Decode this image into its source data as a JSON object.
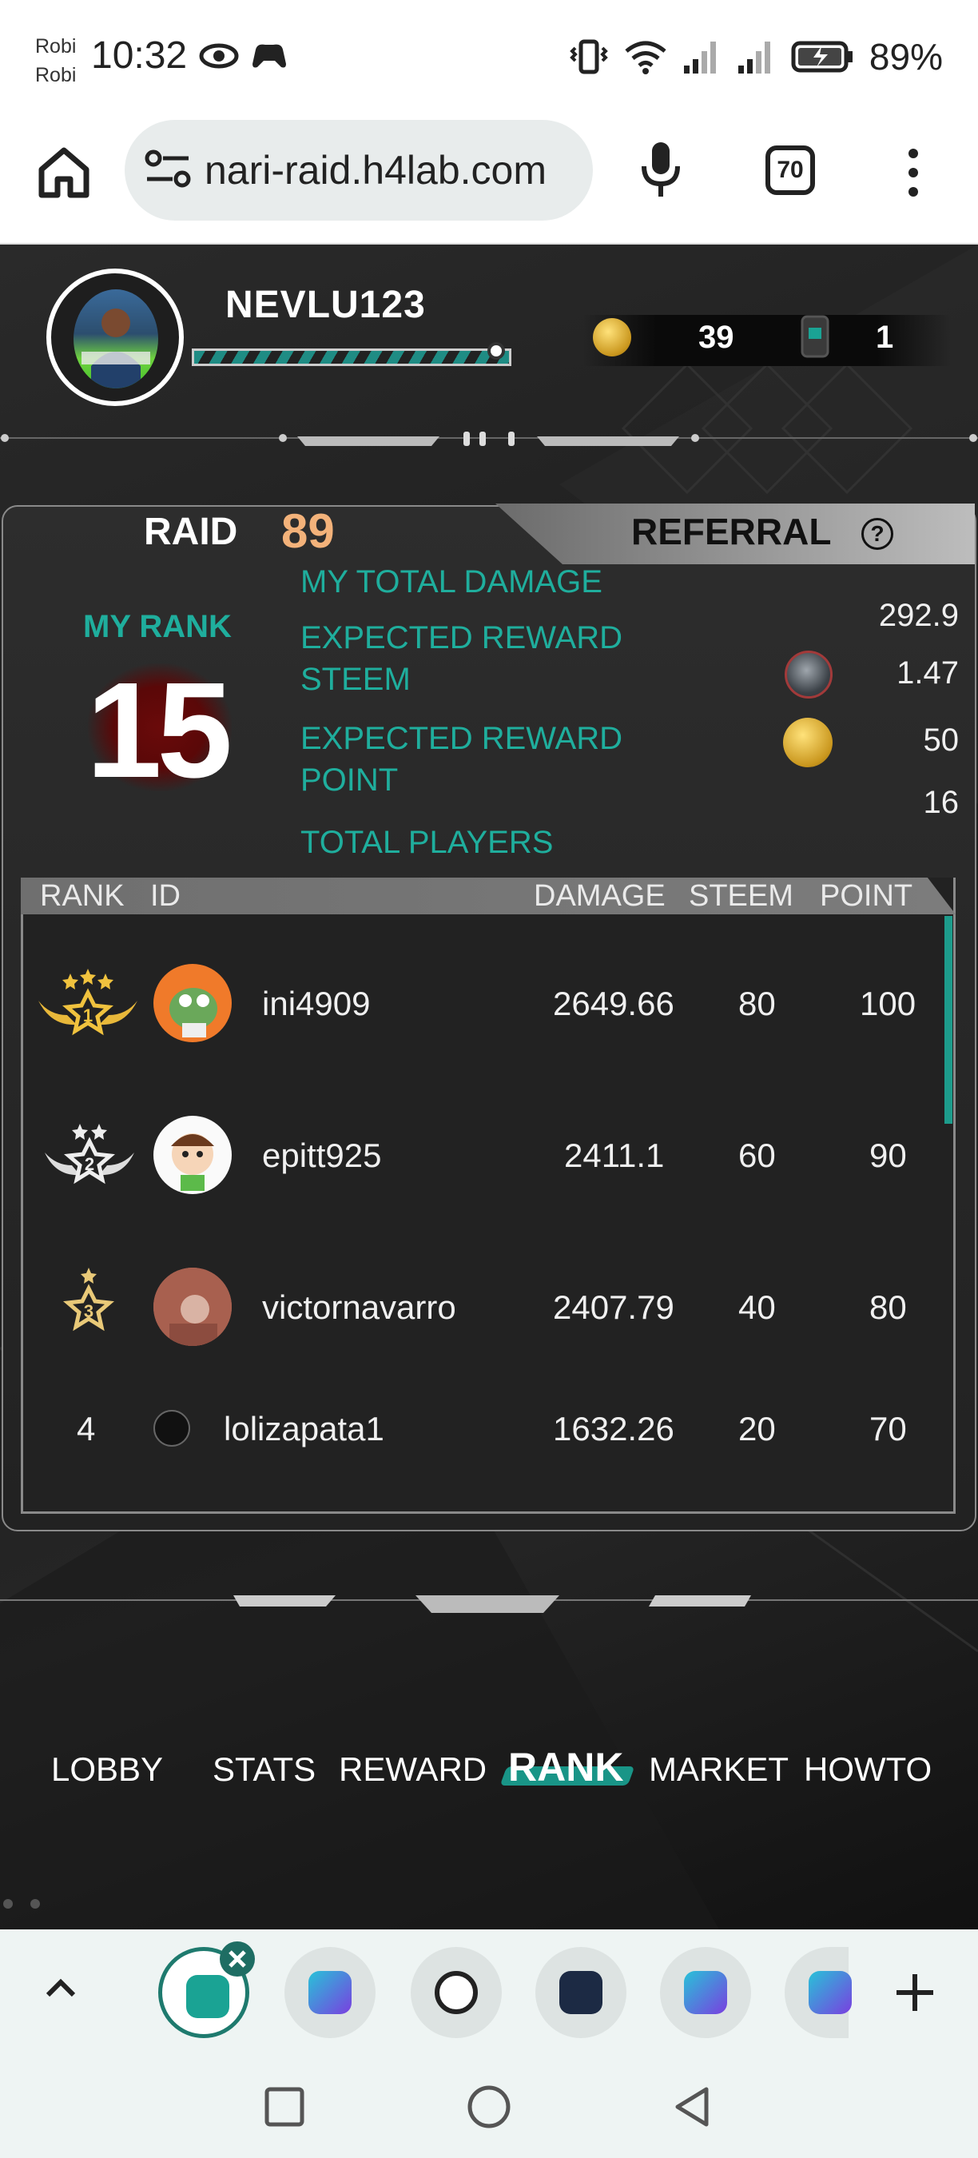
{
  "status_bar": {
    "carrier_1": "Robi",
    "carrier_2": "Robi",
    "time": "10:32",
    "battery": "89%"
  },
  "browser": {
    "url": "nari-raid.h4lab.com",
    "tab_count": "70"
  },
  "player": {
    "username": "NEVLU123",
    "coins": "39",
    "tickets": "1"
  },
  "rank_panel": {
    "raid_label": "RAID",
    "raid_number": "89",
    "referral_label": "REFERRAL",
    "my_rank_label": "MY RANK",
    "my_rank": "15",
    "stats": {
      "total_damage_label": "MY TOTAL DAMAGE",
      "total_damage": "292.9",
      "reward_steem_label_1": "EXPECTED REWARD",
      "reward_steem_label_2": "STEEM",
      "reward_steem": "1.47",
      "reward_point_label_1": "EXPECTED REWARD",
      "reward_point_label_2": "POINT",
      "reward_point": "50",
      "total_players_label": "TOTAL PLAYERS",
      "total_players": "16"
    }
  },
  "table": {
    "headers": [
      "RANK",
      "ID",
      "DAMAGE",
      "STEEM",
      "POINT"
    ],
    "rows": [
      {
        "rank": "1",
        "id": "ini4909",
        "damage": "2649.66",
        "steem": "80",
        "point": "100"
      },
      {
        "rank": "2",
        "id": "epitt925",
        "damage": "2411.1",
        "steem": "60",
        "point": "90"
      },
      {
        "rank": "3",
        "id": "victornavarro",
        "damage": "2407.79",
        "steem": "40",
        "point": "80"
      },
      {
        "rank": "4",
        "id": "lolizapata1",
        "damage": "1632.26",
        "steem": "20",
        "point": "70"
      }
    ]
  },
  "nav": {
    "items": [
      "LOBBY",
      "STATS",
      "REWARD",
      "RANK",
      "MARKET",
      "HOWTO"
    ],
    "active": "RANK"
  }
}
